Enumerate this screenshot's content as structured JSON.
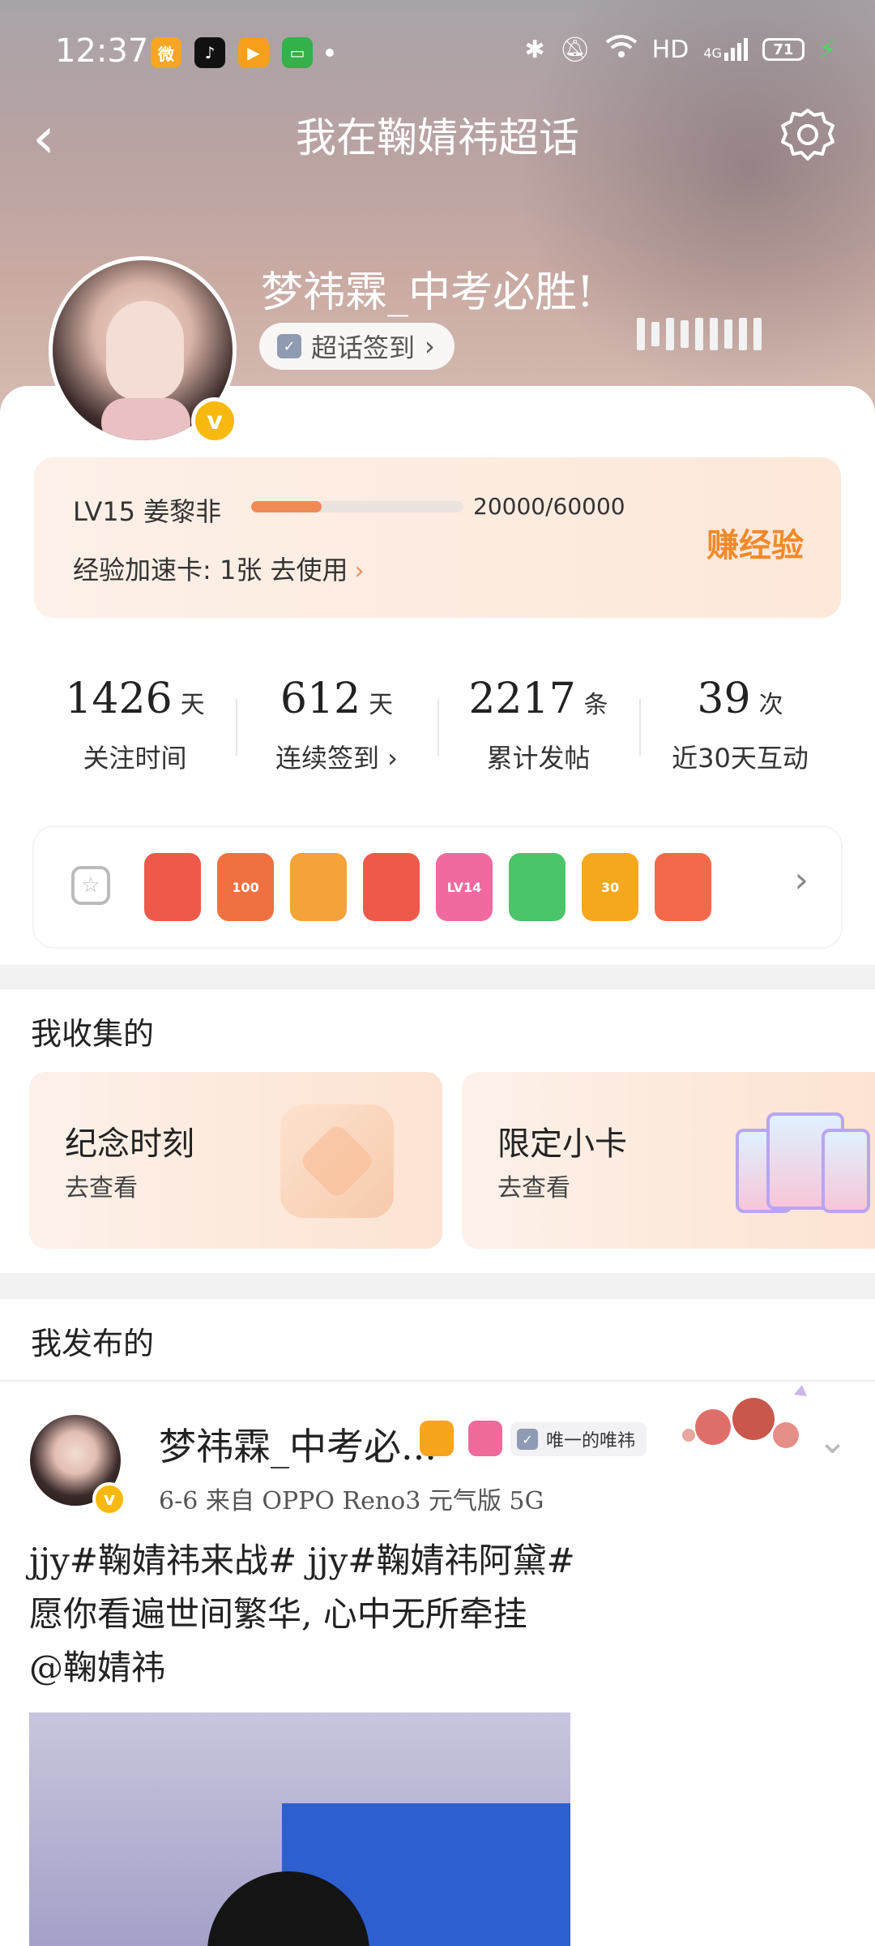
{
  "status_bar": {
    "time": "12:37",
    "apps": [
      {
        "icon": "weibo-icon",
        "color": "#f6a623",
        "glyph": "微"
      },
      {
        "icon": "tiktok-icon",
        "color": "#111111",
        "glyph": "♪"
      },
      {
        "icon": "video-app-icon",
        "color": "#f59f1c",
        "glyph": "▶"
      },
      {
        "icon": "messages-icon",
        "color": "#36b04a",
        "glyph": "▭"
      }
    ],
    "network": "HD",
    "signal_label": "4G",
    "battery": "71"
  },
  "nav": {
    "back": "‹",
    "title": "我在鞠婧祎超话"
  },
  "profile": {
    "username": "梦祎霖_中考必胜!",
    "checkin_label": "超话签到",
    "checkin_chevron": "›",
    "verified_glyph": "v"
  },
  "level": {
    "label": "LV15 姜黎非",
    "progress": "20000/60000",
    "progress_fraction": 0.333,
    "speed_card": "经验加速卡: 1张 去使用",
    "speed_chevron": "›",
    "earn": "赚经验"
  },
  "stats": [
    {
      "value": "1426",
      "unit": "天",
      "label": "关注时间"
    },
    {
      "value": "612",
      "unit": "天",
      "label": "连续签到 ›"
    },
    {
      "value": "2217",
      "unit": "条",
      "label": "累计发帖"
    },
    {
      "value": "39",
      "unit": "次",
      "label": "近30天互动"
    }
  ],
  "badges": {
    "more": "›",
    "items": [
      {
        "icon": "cat-badge-icon",
        "color": "#ee5a4a",
        "text": ""
      },
      {
        "icon": "100-days-badge-icon",
        "color": "#f07040",
        "text": "100"
      },
      {
        "icon": "crown-badge-icon",
        "color": "#f4a23a",
        "text": ""
      },
      {
        "icon": "cat-face-badge-icon",
        "color": "#ee5a4a",
        "text": ""
      },
      {
        "icon": "lv14-badge-icon",
        "color": "#f06aa0",
        "text": "LV14"
      },
      {
        "icon": "hand-badge-icon",
        "color": "#4cc46a",
        "text": ""
      },
      {
        "icon": "30-days-badge-icon",
        "color": "#f5a81e",
        "text": "30"
      },
      {
        "icon": "rock-hand-badge-icon",
        "color": "#f26a4a",
        "text": ""
      }
    ]
  },
  "collected": {
    "title": "我收集的",
    "items": [
      {
        "name": "纪念时刻",
        "action": "去查看"
      },
      {
        "name": "限定小卡",
        "action": "去查看"
      }
    ]
  },
  "posted": {
    "title": "我发布的",
    "post": {
      "author": "梦祎霖_中考必...",
      "tag": "唯一的唯祎",
      "meta": "6-6 来自 OPPO Reno3 元气版 5G",
      "lines": [
        "jjy#鞠婧祎来战# jjy#鞠婧祎阿黛#",
        "愿你看遍世间繁华, 心中无所牵挂",
        "@鞠婧祎"
      ]
    }
  }
}
